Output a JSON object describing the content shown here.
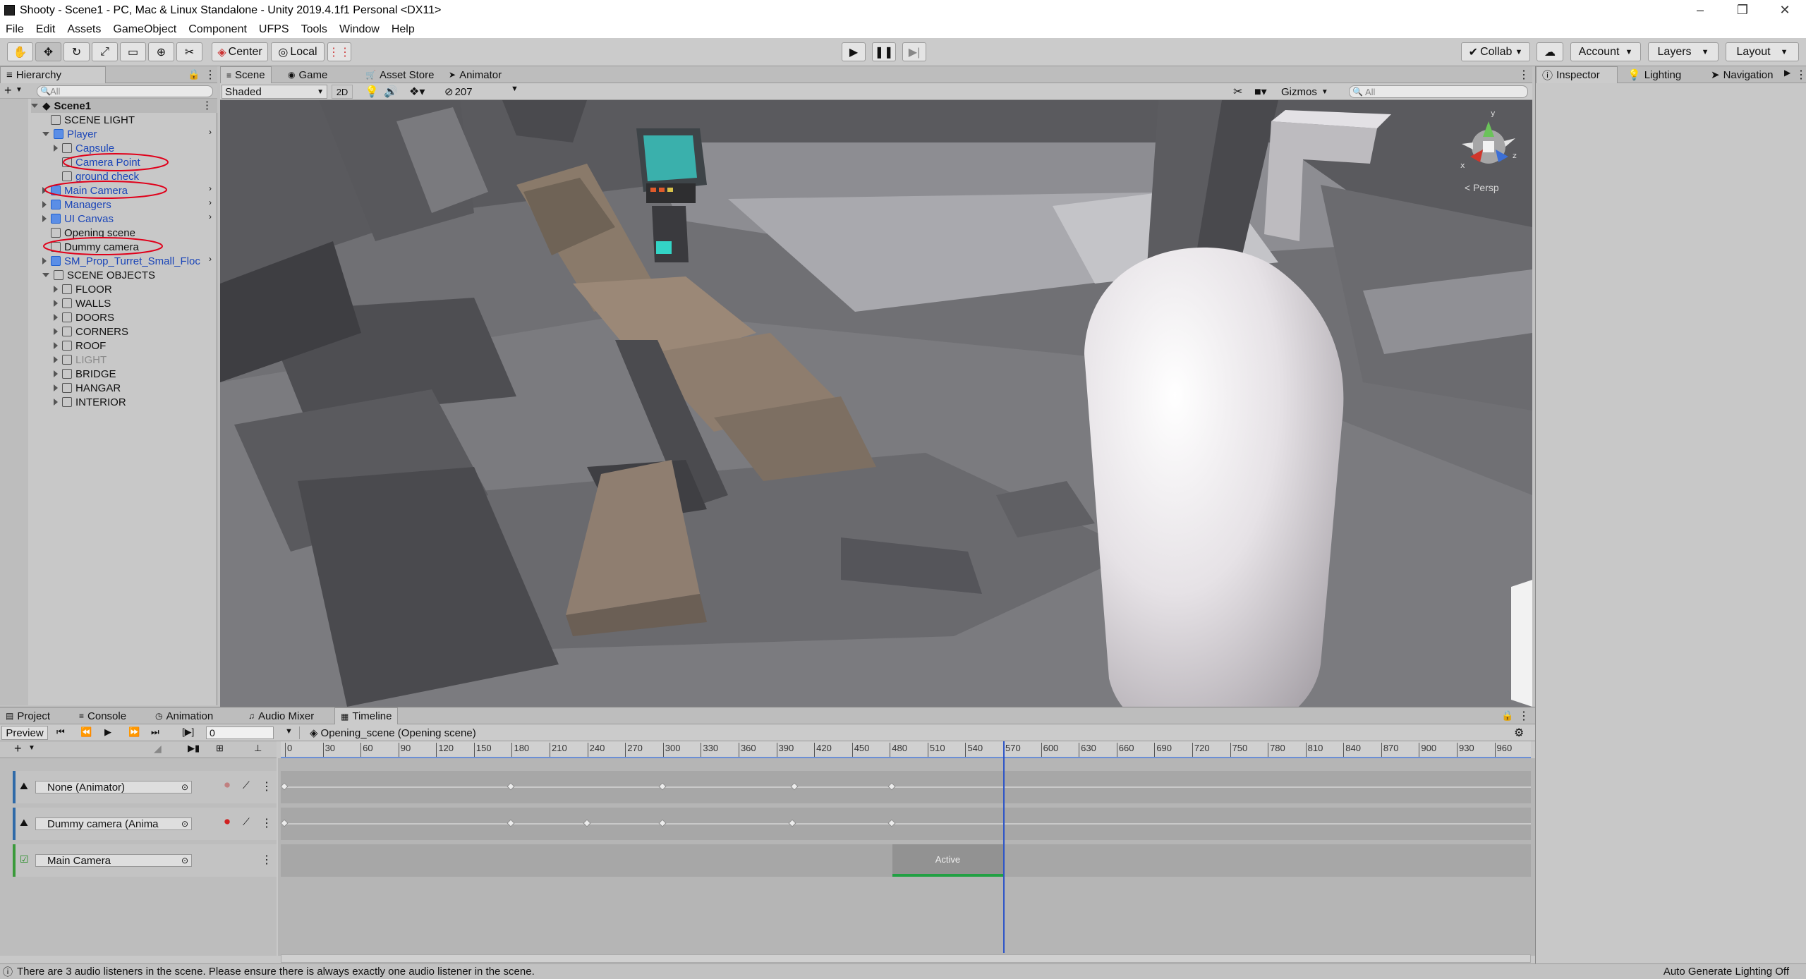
{
  "window": {
    "title": "Shooty - Scene1 - PC, Mac & Linux Standalone - Unity 2019.4.1f1 Personal <DX11>"
  },
  "menu": [
    "File",
    "Edit",
    "Assets",
    "GameObject",
    "Component",
    "UFPS",
    "Tools",
    "Window",
    "Help"
  ],
  "toolbar": {
    "center_label": "Center",
    "local_label": "Local",
    "collab_label": "Collab",
    "account_label": "Account",
    "layers_label": "Layers",
    "layout_label": "Layout"
  },
  "hierarchy": {
    "tab": "Hierarchy",
    "search_placeholder": "All",
    "scene": "Scene1",
    "items": [
      {
        "label": "SCENE LIGHT",
        "indent": 1,
        "color": "normal",
        "expand": "none",
        "icon": "cube"
      },
      {
        "label": "Player",
        "indent": 1,
        "color": "blue",
        "expand": "open",
        "icon": "cube-blue",
        "more": true
      },
      {
        "label": "Capsule",
        "indent": 2,
        "color": "blue",
        "expand": "closed",
        "icon": "cube"
      },
      {
        "label": "Camera Point",
        "indent": 2,
        "color": "blue",
        "expand": "none",
        "icon": "cube",
        "circled": true
      },
      {
        "label": "ground check",
        "indent": 2,
        "color": "blue",
        "expand": "none",
        "icon": "cube"
      },
      {
        "label": "Main Camera",
        "indent": 1,
        "color": "blue",
        "expand": "closed",
        "icon": "cube-blue",
        "circled": true,
        "more": true
      },
      {
        "label": "Managers",
        "indent": 1,
        "color": "blue",
        "expand": "closed",
        "icon": "cube-blue",
        "more": true
      },
      {
        "label": "UI Canvas",
        "indent": 1,
        "color": "blue",
        "expand": "closed",
        "icon": "cube-blue",
        "more": true
      },
      {
        "label": "Opening scene",
        "indent": 1,
        "color": "normal",
        "expand": "none",
        "icon": "cube"
      },
      {
        "label": "Dummy camera",
        "indent": 1,
        "color": "normal",
        "expand": "none",
        "icon": "cube",
        "circled": true
      },
      {
        "label": "SM_Prop_Turret_Small_Floc",
        "indent": 1,
        "color": "blue",
        "expand": "closed",
        "icon": "cube-blue",
        "more": true
      },
      {
        "label": "SCENE OBJECTS",
        "indent": 1,
        "color": "normal",
        "expand": "open",
        "icon": "cube"
      },
      {
        "label": "FLOOR",
        "indent": 2,
        "color": "normal",
        "expand": "closed",
        "icon": "cube"
      },
      {
        "label": "WALLS",
        "indent": 2,
        "color": "normal",
        "expand": "closed",
        "icon": "cube"
      },
      {
        "label": "DOORS",
        "indent": 2,
        "color": "normal",
        "expand": "closed",
        "icon": "cube"
      },
      {
        "label": "CORNERS",
        "indent": 2,
        "color": "normal",
        "expand": "closed",
        "icon": "cube"
      },
      {
        "label": "ROOF",
        "indent": 2,
        "color": "normal",
        "expand": "closed",
        "icon": "cube"
      },
      {
        "label": "LIGHT",
        "indent": 2,
        "color": "dim",
        "expand": "closed",
        "icon": "cube"
      },
      {
        "label": "BRIDGE",
        "indent": 2,
        "color": "normal",
        "expand": "closed",
        "icon": "cube"
      },
      {
        "label": "HANGAR",
        "indent": 2,
        "color": "normal",
        "expand": "closed",
        "icon": "cube"
      },
      {
        "label": "INTERIOR",
        "indent": 2,
        "color": "normal",
        "expand": "closed",
        "icon": "cube"
      }
    ]
  },
  "scene_tabs": [
    "Scene",
    "Game",
    "Asset Store",
    "Animator"
  ],
  "scene_toolbar": {
    "shading": "Shaded",
    "mode2d": "2D",
    "hidden_count": "207",
    "gizmos": "Gizmos",
    "search_placeholder": "All",
    "persp": "< Persp"
  },
  "inspector_tabs": [
    "Inspector",
    "Lighting",
    "Navigation"
  ],
  "bottom_tabs": [
    "Project",
    "Console",
    "Animation",
    "Audio Mixer",
    "Timeline"
  ],
  "timeline": {
    "preview": "Preview",
    "frame": "0",
    "asset": "Opening_scene (Opening scene)",
    "ruler": [
      "0",
      "30",
      "60",
      "90",
      "120",
      "150",
      "180",
      "210",
      "240",
      "270",
      "300",
      "330",
      "360",
      "390",
      "420",
      "450",
      "480",
      "510",
      "540",
      "570",
      "600",
      "630",
      "660",
      "690",
      "720",
      "750",
      "780",
      "810",
      "840",
      "870",
      "900",
      "930",
      "960"
    ],
    "playhead_frame": 570,
    "tracks": [
      {
        "label": "None (Animator)",
        "keys": [
          0,
          180,
          300,
          405,
          482
        ]
      },
      {
        "label": "Dummy camera (Anima",
        "keys": [
          0,
          180,
          240,
          300,
          403,
          482
        ]
      },
      {
        "label": "Main Camera",
        "clip_label": "Active",
        "clip_start": 482,
        "clip_end": 570
      }
    ]
  },
  "status": {
    "message": "There are 3 audio listeners in the scene. Please ensure there is always exactly one audio listener in the scene.",
    "right": "Auto Generate Lighting Off"
  }
}
